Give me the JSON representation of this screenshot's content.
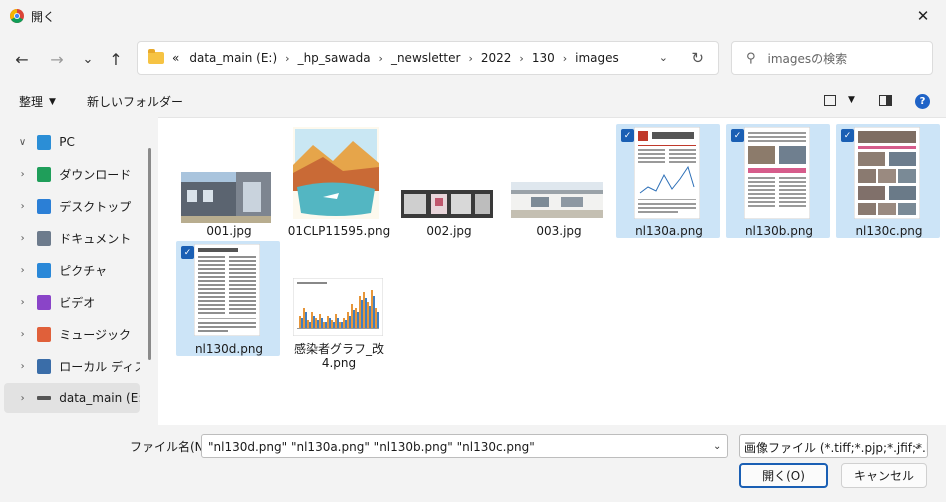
{
  "window": {
    "title": "開く",
    "close_glyph": "✕"
  },
  "nav": {
    "back": "←",
    "forward": "→",
    "recent": "⌄",
    "up": "↑"
  },
  "address": {
    "crumbs": [
      "«",
      "data_main (E:)",
      "_hp_sawada",
      "_newsletter",
      "2022",
      "130",
      "images"
    ],
    "separator": "›",
    "dropdown": "⌄",
    "refresh": "↻"
  },
  "search": {
    "placeholder": "imagesの検索",
    "icon": "⚲"
  },
  "toolbar": {
    "organize": "整理",
    "new_folder": "新しいフォルダー",
    "help": "?"
  },
  "sidebar": {
    "items": [
      {
        "label": "PC",
        "icon": "pc-icon",
        "color": "#2b8ed6",
        "expanded": true
      },
      {
        "label": "ダウンロード",
        "icon": "download-icon",
        "color": "#1f9e5a"
      },
      {
        "label": "デスクトップ",
        "icon": "desktop-icon",
        "color": "#2b7fd6"
      },
      {
        "label": "ドキュメント",
        "icon": "document-icon",
        "color": "#6d7b8c"
      },
      {
        "label": "ピクチャ",
        "icon": "pictures-icon",
        "color": "#2a88d8"
      },
      {
        "label": "ビデオ",
        "icon": "video-icon",
        "color": "#8a44c8"
      },
      {
        "label": "ミュージック",
        "icon": "music-icon",
        "color": "#e0603a"
      },
      {
        "label": "ローカル ディスク (",
        "icon": "local-disk-icon",
        "color": "#3a6da8"
      },
      {
        "label": "data_main (E:)",
        "icon": "drive-icon",
        "color": "#555555",
        "selected": true
      }
    ]
  },
  "files": [
    {
      "name": "001.jpg",
      "selected": false
    },
    {
      "name": "01CLP11595.png",
      "selected": false
    },
    {
      "name": "002.jpg",
      "selected": false
    },
    {
      "name": "003.jpg",
      "selected": false
    },
    {
      "name": "nl130a.png",
      "selected": true
    },
    {
      "name": "nl130b.png",
      "selected": true
    },
    {
      "name": "nl130c.png",
      "selected": true
    },
    {
      "name": "nl130d.png",
      "selected": true
    },
    {
      "name": "感染者グラフ_改4.png",
      "selected": false
    }
  ],
  "bottom": {
    "filename_label": "ファイル名(N):",
    "filename_value": "\"nl130d.png\" \"nl130a.png\" \"nl130b.png\" \"nl130c.png\"",
    "filetype_value": "画像ファイル (*.tiff;*.pjp;*.jfif;*.bmp",
    "open_label": "開く(O)",
    "cancel_label": "キャンセル"
  },
  "colors": {
    "selection": "#cce4f7",
    "accent": "#1a5fb4"
  }
}
